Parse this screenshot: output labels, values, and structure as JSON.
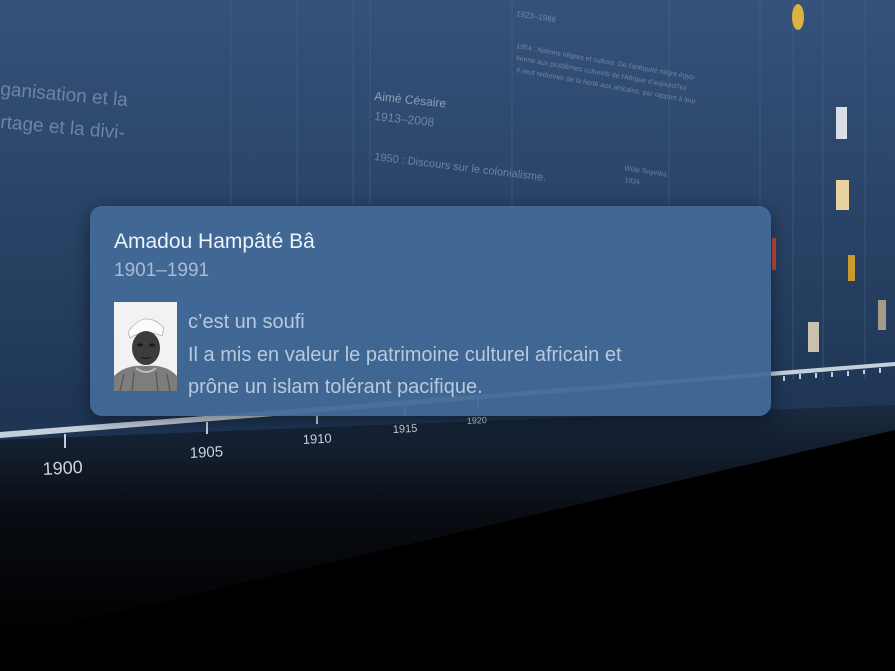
{
  "background_text": {
    "left_line_1": "ganisation et la",
    "left_line_2": "rtage et la divi-",
    "cesaire_name": "Aimé Césaire",
    "cesaire_years": "1913–2008",
    "cesaire_event": "1950 : Discours sur le colonialisme.",
    "diop_years": "1923–1986",
    "diop_event_line_1": "1954 : Nations nègres et culture. De l'antiquité nègre égyp-",
    "diop_event_line_2": "tienne aux problèmes culturels de l'Afrique d'aujourd'hui",
    "diop_event_line_3": "Il veut redonner de la fierté aux africains, par rapport à leur",
    "soyinka_name": "Wole Soyinka",
    "soyinka_years": "1934"
  },
  "timeline": {
    "years": [
      "1900",
      "1905",
      "1910",
      "1915",
      "1920"
    ]
  },
  "popup": {
    "name": "Amadou Hampâté Bâ",
    "years": "1901–1991",
    "line1": "c’est un soufi",
    "line2": "Il a mis en valeur le patrimoine culturel africain et",
    "line3": "prône un islam tolérant pacifique."
  },
  "colors": {
    "wall_top": "#2e4a6e",
    "wall_bottom": "#1f3654",
    "floor": "#0b0f16",
    "popup": "#426998",
    "axis": "#b9c8d8"
  }
}
